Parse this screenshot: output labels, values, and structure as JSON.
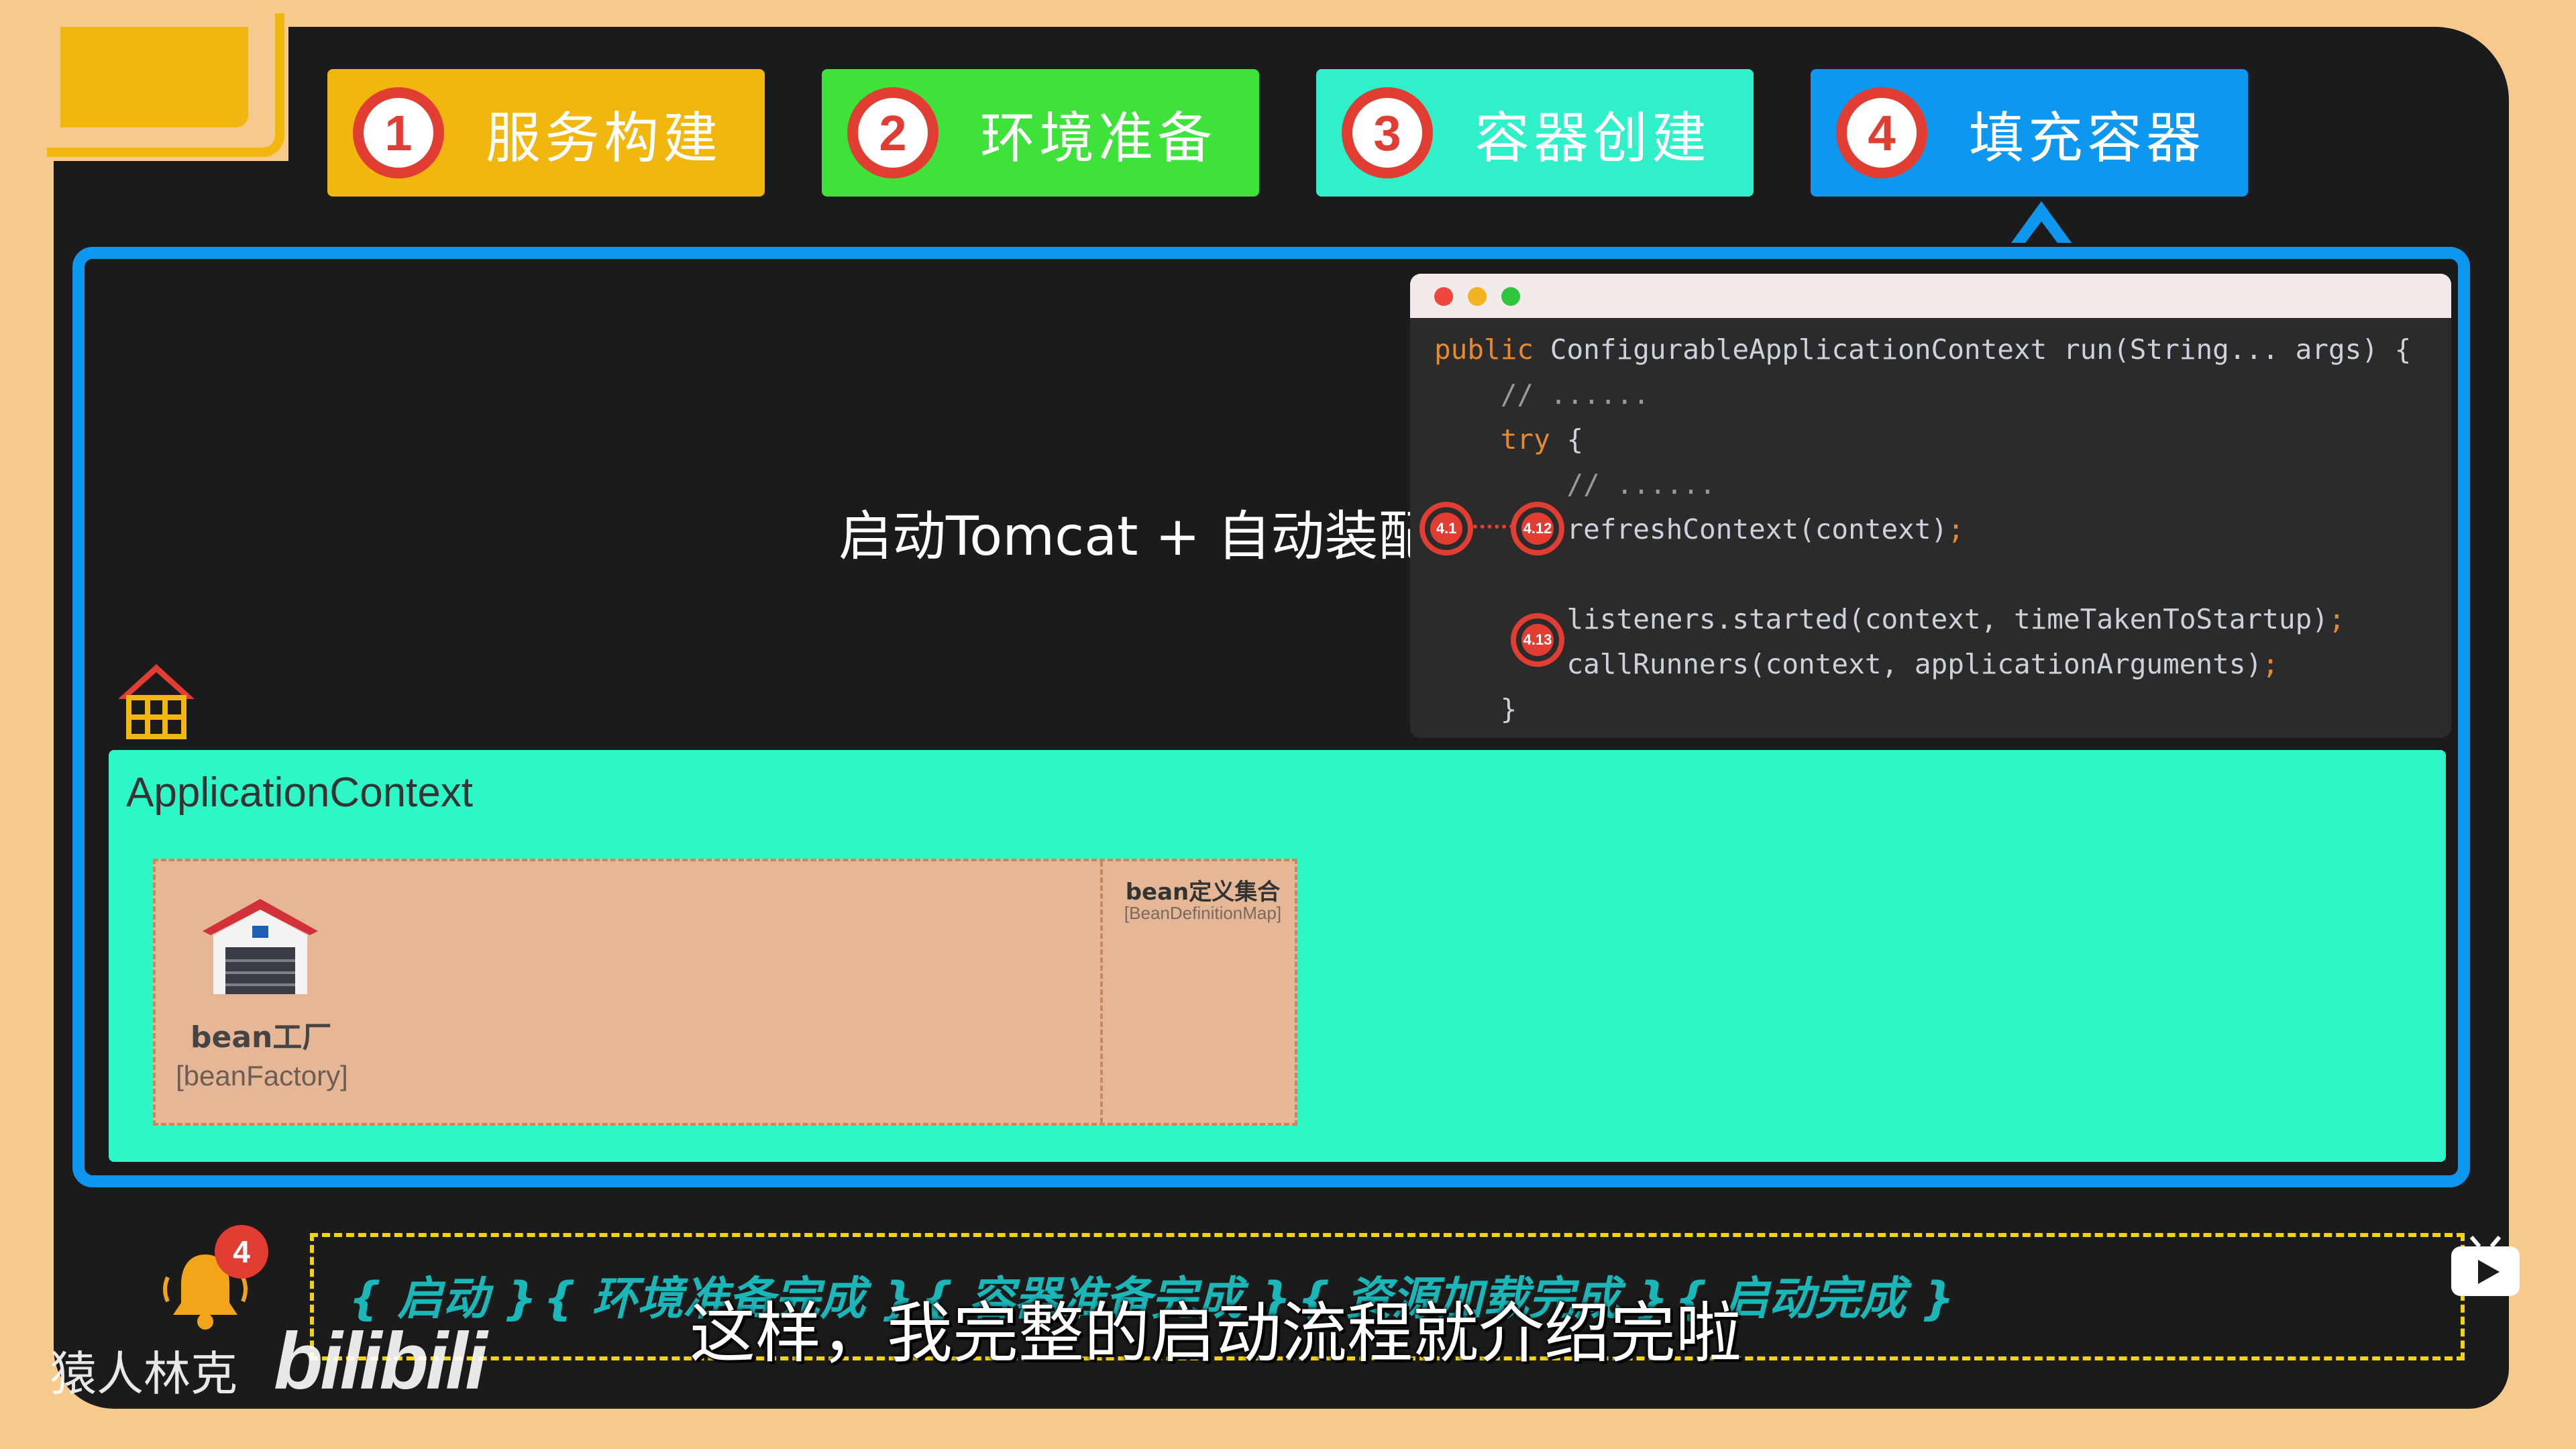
{
  "steps_tabs": [
    {
      "num": "1",
      "label": "服务构建"
    },
    {
      "num": "2",
      "label": "环境准备"
    },
    {
      "num": "3",
      "label": "容器创建"
    },
    {
      "num": "4",
      "label": "填充容器"
    }
  ],
  "headline": "启动Tomcat + 自动装配",
  "code": {
    "line1_kw": "public",
    "line1_rest": " ConfigurableApplicationContext run(String... args) {",
    "line2": "    // ......",
    "line3_kw": "    try",
    "line3_rest": " {",
    "line4": "        // ......",
    "line5": "        refreshContext(context)",
    "line7": "        listeners.started(context, timeTakenToStartup)",
    "line8": "        callRunners(context, applicationArguments)",
    "line9": "    }",
    "semicolon": ";"
  },
  "markers": {
    "m1": "4.1",
    "m2": "4.12",
    "m3": "4.13"
  },
  "app_context": {
    "title": "ApplicationContext",
    "bean_factory_name": "bean工厂",
    "bean_factory_sub": "[beanFactory]",
    "bean_map_title": "bean定义集合",
    "bean_map_sub": "[BeanDefinitionMap]"
  },
  "timeline": {
    "steps": [
      "{ 启动 }",
      "{ 环境准备完成 }",
      "{ 容器准备完成 }",
      "{ 资源加载完成 }",
      "{ 启动完成 }"
    ]
  },
  "subtitle": "这样，我完整的启动流程就介绍完啦",
  "notification_count": "4",
  "author": "猿人林克",
  "logo_text": "bilibili",
  "colors": {
    "tab1": "#f2b70e",
    "tab2": "#3fe23a",
    "tab3": "#2ff0c8",
    "tab4": "#0d97ef",
    "accent_red": "#e23d33",
    "app_context_bg": "#2df6c7"
  }
}
